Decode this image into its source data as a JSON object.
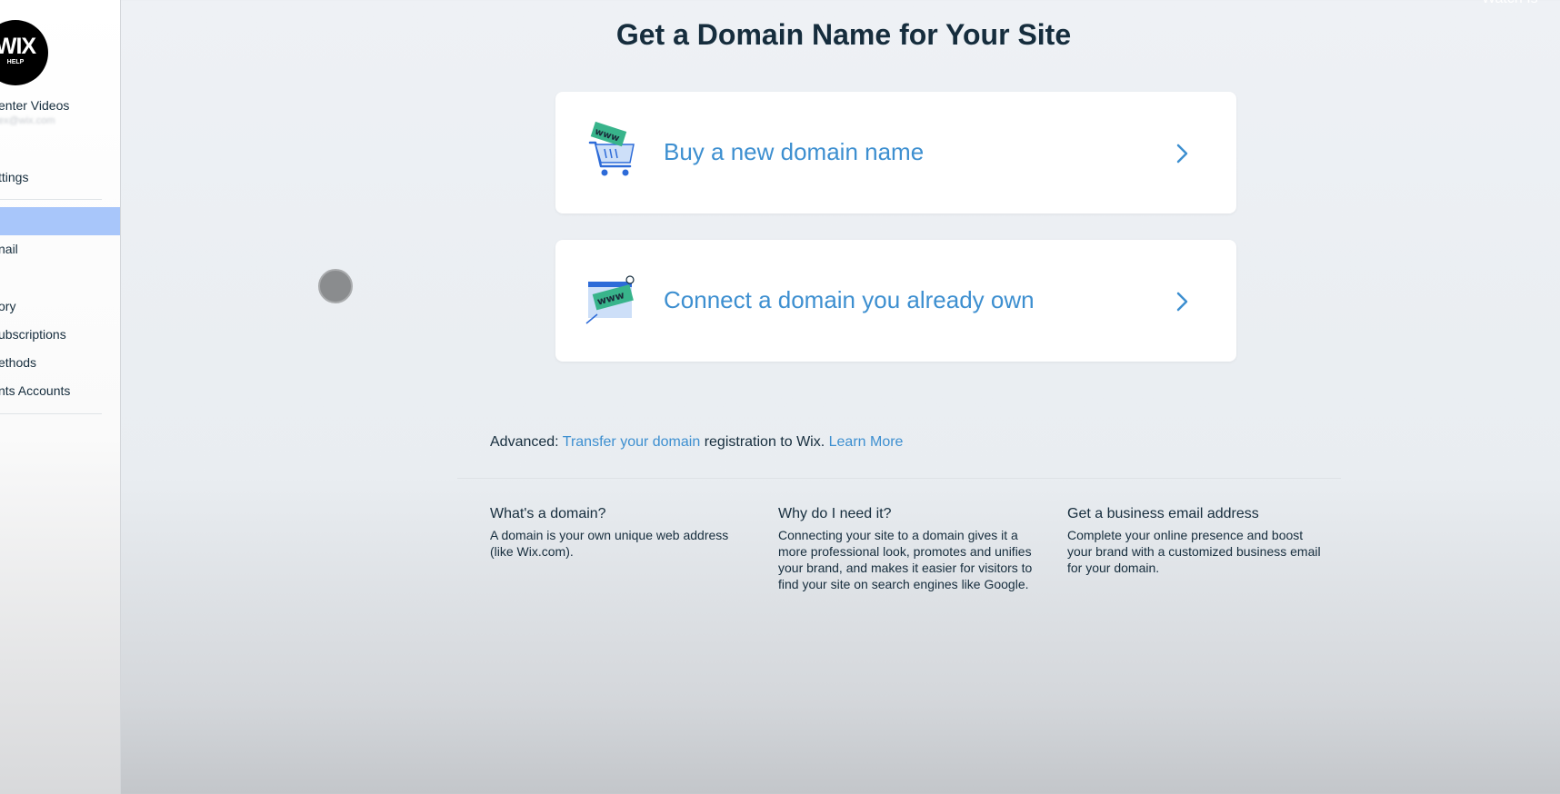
{
  "sidebar": {
    "logo_text": "WIX",
    "logo_subtext": "HELP",
    "site_name": "enter Videos",
    "site_email": "ex@wix.com",
    "items": [
      {
        "label": "ttings"
      },
      {
        "label": ""
      },
      {
        "label": "nail"
      },
      {
        "label": "ory"
      },
      {
        "label": "ubscriptions"
      },
      {
        "label": "ethods"
      },
      {
        "label": "nts Accounts"
      }
    ]
  },
  "main": {
    "title": "Get a Domain Name for Your Site",
    "options": [
      {
        "label": "Buy a new domain name",
        "icon": "shopping-cart-www-icon"
      },
      {
        "label": "Connect a domain you already own",
        "icon": "browser-www-tag-icon"
      }
    ],
    "advanced": {
      "prefix": "Advanced:",
      "transfer_link": "Transfer your domain",
      "middle": "registration to Wix.",
      "learn_more": "Learn More"
    },
    "info": [
      {
        "heading": "What's a domain?",
        "body": "A domain is your own unique web address (like Wix.com)."
      },
      {
        "heading": "Why do I need it?",
        "body": "Connecting your site to a domain gives it a more professional look, promotes and unifies your brand, and makes it easier for visitors to find your site on search engines like Google."
      },
      {
        "heading": "Get a business email address",
        "body": "Complete your online presence and boost your brand with a customized business email for your domain."
      }
    ]
  },
  "corner_text": "Watch Is",
  "colors": {
    "accent": "#3d8fd0",
    "active_item": "#a8c6fa",
    "text": "#162d3d"
  }
}
